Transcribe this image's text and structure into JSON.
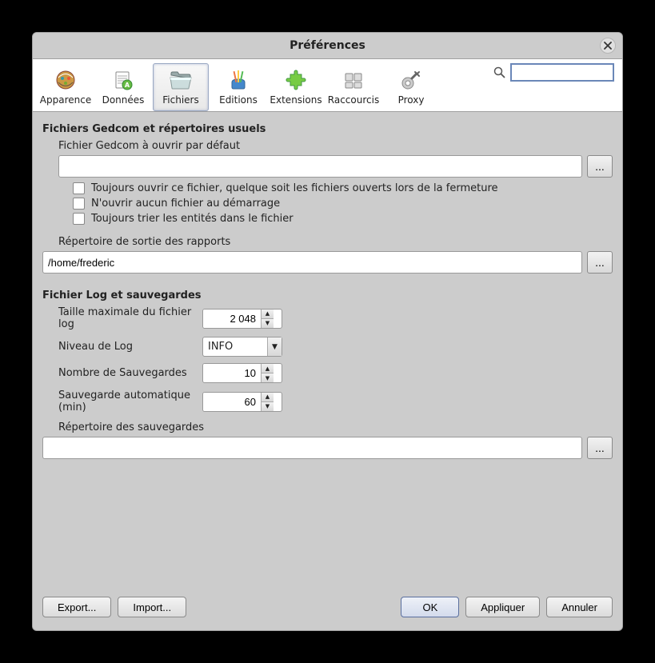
{
  "window": {
    "title": "Préférences"
  },
  "tabs": {
    "appearance": "Apparence",
    "data": "Données",
    "files": "Fichiers",
    "editions": "Editions",
    "extensions": "Extensions",
    "shortcuts": "Raccourcis",
    "proxy": "Proxy"
  },
  "search": {
    "value": ""
  },
  "section1": {
    "title": "Fichiers Gedcom et répertoires usuels",
    "gedcom_label": "Fichier Gedcom à ouvrir par défaut",
    "gedcom_value": "",
    "browse": "...",
    "chk_always_open": "Toujours ouvrir ce fichier, quelque soit les fichiers ouverts lors de la fermeture",
    "chk_no_open": "N'ouvrir aucun fichier au démarrage",
    "chk_sort": "Toujours trier les entités dans le fichier",
    "reports_dir_label": "Répertoire de sortie des rapports",
    "reports_dir_value": "/home/frederic"
  },
  "section2": {
    "title": "Fichier Log et sauvegardes",
    "log_size_label": "Taille maximale du fichier log",
    "log_size_value": "2 048",
    "log_level_label": "Niveau de Log",
    "log_level_value": "INFO",
    "backup_count_label": "Nombre de Sauvegardes",
    "backup_count_value": "10",
    "auto_backup_label": "Sauvegarde automatique (min)",
    "auto_backup_value": "60",
    "backup_dir_label": "Répertoire des sauvegardes",
    "backup_dir_value": ""
  },
  "footer": {
    "export": "Export...",
    "import": "Import...",
    "ok": "OK",
    "apply": "Appliquer",
    "cancel": "Annuler"
  }
}
